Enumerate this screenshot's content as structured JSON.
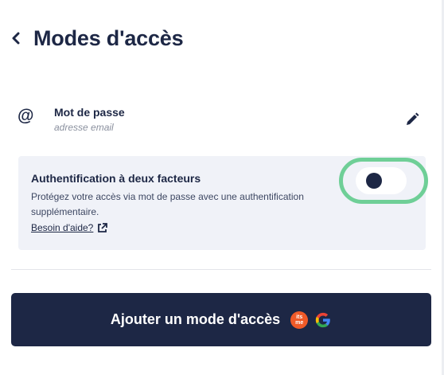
{
  "header": {
    "title": "Modes d'accès"
  },
  "method": {
    "icon": "at-icon",
    "title": "Mot de passe",
    "subtitle": "adresse email"
  },
  "two_factor": {
    "title": "Authentification à deux facteurs",
    "description": "Protégez votre accès via mot de passe avec une authentification supplémentaire.",
    "help_link": "Besoin d'aide?",
    "enabled": false
  },
  "add_button": {
    "label": "Ajouter un mode d'accès",
    "itsme_text": "its me"
  },
  "colors": {
    "primary": "#1d2745",
    "highlight": "#6fcf97",
    "card_bg": "#f0f2f8",
    "itsme": "#f05a28"
  }
}
